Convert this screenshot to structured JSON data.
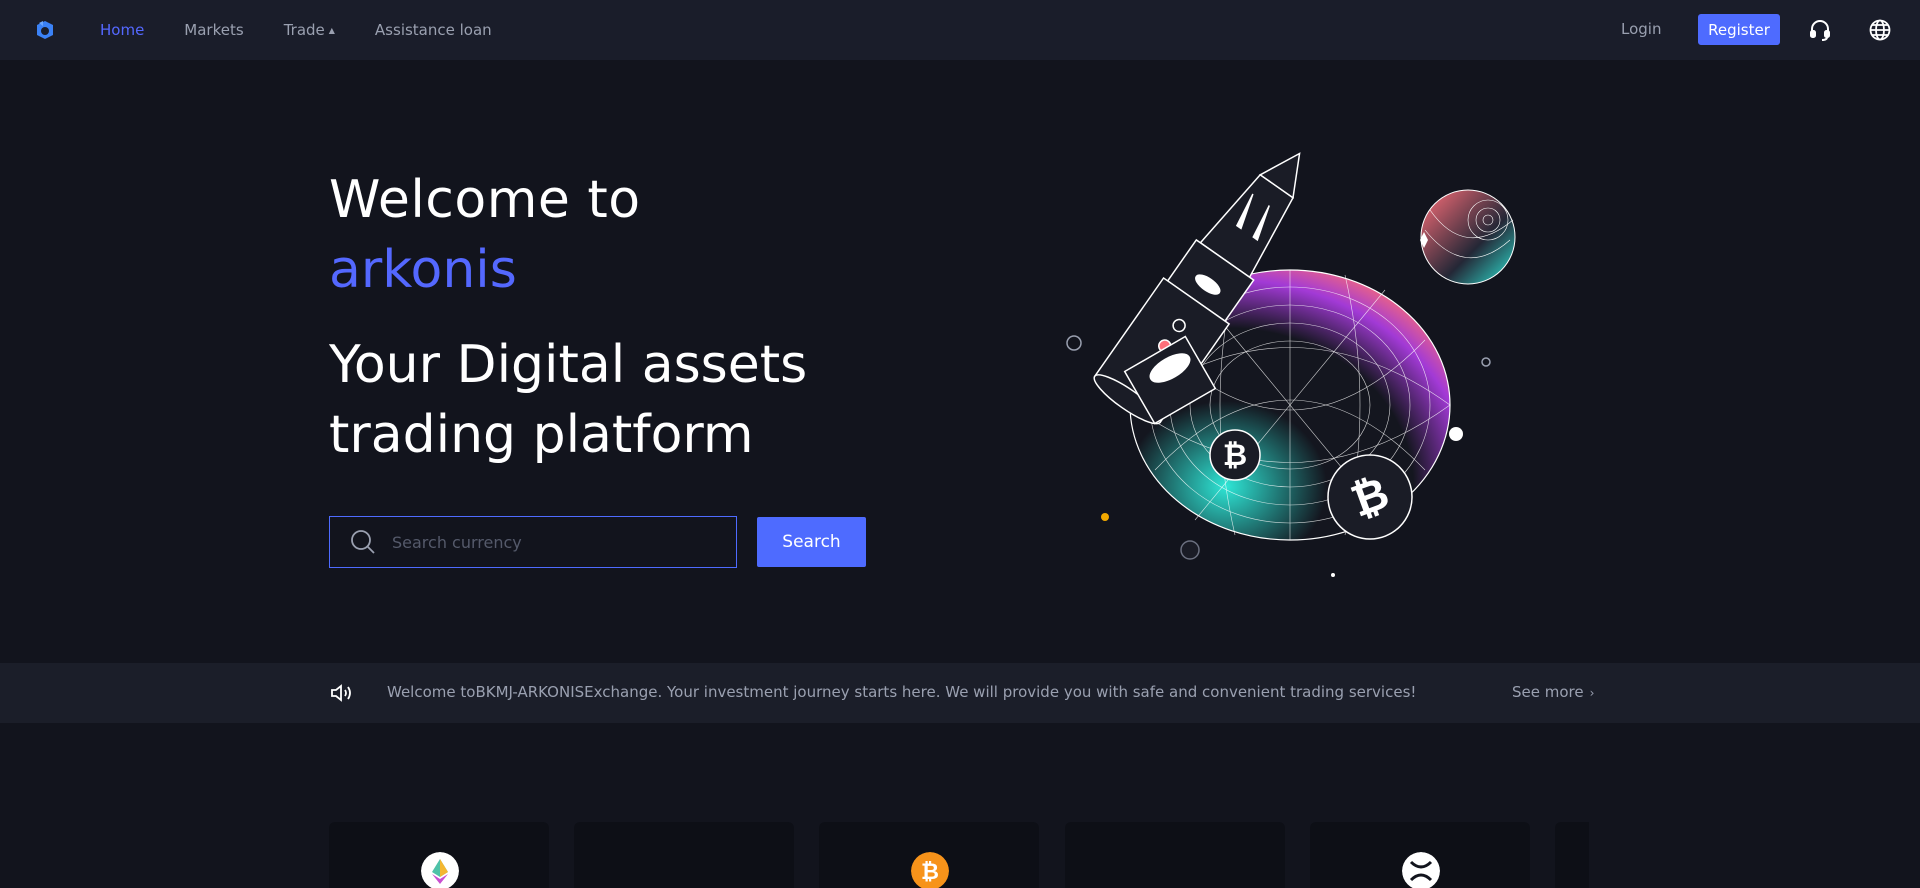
{
  "nav": {
    "items": [
      {
        "label": "Home",
        "active": true
      },
      {
        "label": "Markets",
        "active": false
      },
      {
        "label": "Trade",
        "active": false,
        "has_caret": true
      },
      {
        "label": "Assistance loan",
        "active": false
      }
    ],
    "login_label": "Login",
    "register_label": "Register",
    "icons": [
      "logo-icon",
      "headset-icon",
      "globe-icon"
    ]
  },
  "hero": {
    "welcome": "Welcome to",
    "brand": "arkonis",
    "tagline": "Your Digital assets trading platform",
    "search_placeholder": "Search currency",
    "search_button": "Search"
  },
  "announcement": {
    "text": "Welcome toBKMJ-ARKONISExchange. Your investment journey starts here. We will provide you with safe and convenient trading services!",
    "see_more": "See more",
    "icon": "speaker-icon"
  },
  "cards": [
    {
      "coin": "eth-icon"
    },
    {
      "coin": ""
    },
    {
      "coin": "btc-icon"
    },
    {
      "coin": ""
    },
    {
      "coin": "xrp-icon"
    },
    {
      "coin": ""
    }
  ],
  "colors": {
    "background": "#12141d",
    "topbar": "#1a1d2a",
    "accent": "#4e6bff",
    "brand_text": "#5468ff",
    "muted_text": "#9aa0b0",
    "btc_orange": "#f7931a"
  }
}
